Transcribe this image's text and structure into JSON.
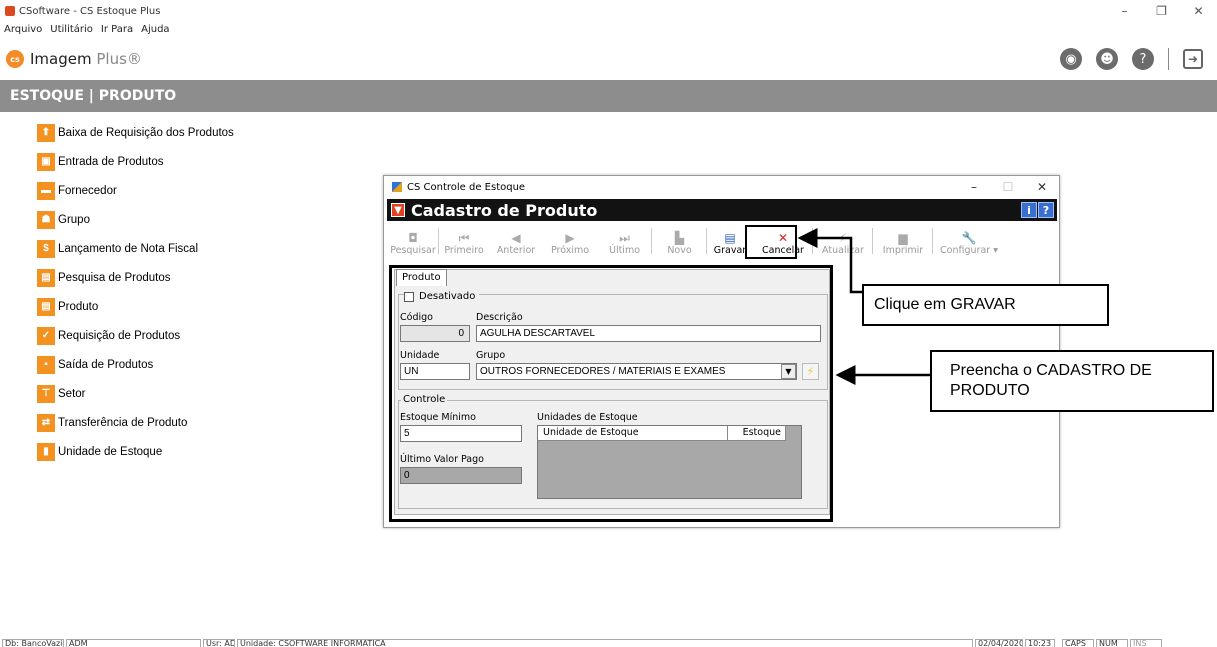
{
  "window": {
    "title": "CSoftware - CS Estoque Plus",
    "controls": [
      "–",
      "❐",
      "✕"
    ]
  },
  "menubar": [
    "Arquivo",
    "Utilitário",
    "Ir Para",
    "Ajuda"
  ],
  "brand": {
    "logo_text": "cs",
    "name": "Imagem",
    "name_plus": "Plus®"
  },
  "module_header": "ESTOQUE | PRODUTO",
  "left_menu": [
    {
      "label": "Baixa de Requisição dos Produtos",
      "icon": "upload-box-icon"
    },
    {
      "label": "Entrada de Produtos",
      "icon": "box-in-icon"
    },
    {
      "label": "Fornecedor",
      "icon": "truck-icon"
    },
    {
      "label": "Grupo",
      "icon": "group-icon"
    },
    {
      "label": "Lançamento de Nota Fiscal",
      "icon": "dollar-icon"
    },
    {
      "label": "Pesquisa de Produtos",
      "icon": "database-icon"
    },
    {
      "label": "Produto",
      "icon": "database-icon"
    },
    {
      "label": "Requisição de Produtos",
      "icon": "check-icon"
    },
    {
      "label": "Saída de Produtos",
      "icon": "box-out-icon"
    },
    {
      "label": "Setor",
      "icon": "org-chart-icon"
    },
    {
      "label": "Transferência de Produto",
      "icon": "transfer-icon"
    },
    {
      "label": "Unidade de Estoque",
      "icon": "unit-icon"
    }
  ],
  "dialog": {
    "title": "CS Controle de Estoque",
    "header": "Cadastro de Produto",
    "toolbar": [
      {
        "label": "Pesquisar",
        "icon": "binoculars-icon"
      },
      {
        "label": "Primeiro",
        "icon": "first-icon"
      },
      {
        "label": "Anterior",
        "icon": "prev-icon"
      },
      {
        "label": "Próximo",
        "icon": "next-icon"
      },
      {
        "label": "Último",
        "icon": "last-icon"
      },
      {
        "label": "Novo",
        "icon": "new-icon"
      },
      {
        "label": "Gravar",
        "icon": "save-icon"
      },
      {
        "label": "Cancelar",
        "icon": "cancel-icon"
      },
      {
        "label": "Atualizar",
        "icon": "refresh-icon"
      },
      {
        "label": "Imprimir",
        "icon": "print-icon"
      },
      {
        "label": "Configurar",
        "icon": "wrench-icon"
      }
    ],
    "tab": "Produto",
    "desativado_label": "Desativado",
    "codigo": {
      "label": "Código",
      "value": "0"
    },
    "descricao": {
      "label": "Descrição",
      "value": "AGULHA DESCARTAVEL"
    },
    "unidade": {
      "label": "Unidade",
      "value": "UN"
    },
    "grupo": {
      "label": "Grupo",
      "value": "OUTROS FORNECEDORES / MATERIAIS E EXAMES"
    },
    "controle_label": "Controle",
    "estoque_minimo": {
      "label": "Estoque Mínimo",
      "value": "5"
    },
    "ultimo_valor": {
      "label": "Último Valor Pago",
      "value": "0"
    },
    "unidades_estoque": {
      "label": "Unidades de Estoque",
      "col1": "Unidade de Estoque",
      "col2": "Estoque"
    }
  },
  "callouts": {
    "gravar": "Clique em GRAVAR",
    "cadastro": "Preencha o CADASTRO DE PRODUTO"
  },
  "statusbar": {
    "db": "Db: BancoVazio",
    "user_short": "ADM",
    "usr": "Usr: ADM",
    "unidade": "Unidade: CSOFTWARE INFORMATICA",
    "date": "02/04/2020",
    "time": "10:23",
    "caps": "CAPS",
    "num": "NUM",
    "ins": "INS"
  }
}
